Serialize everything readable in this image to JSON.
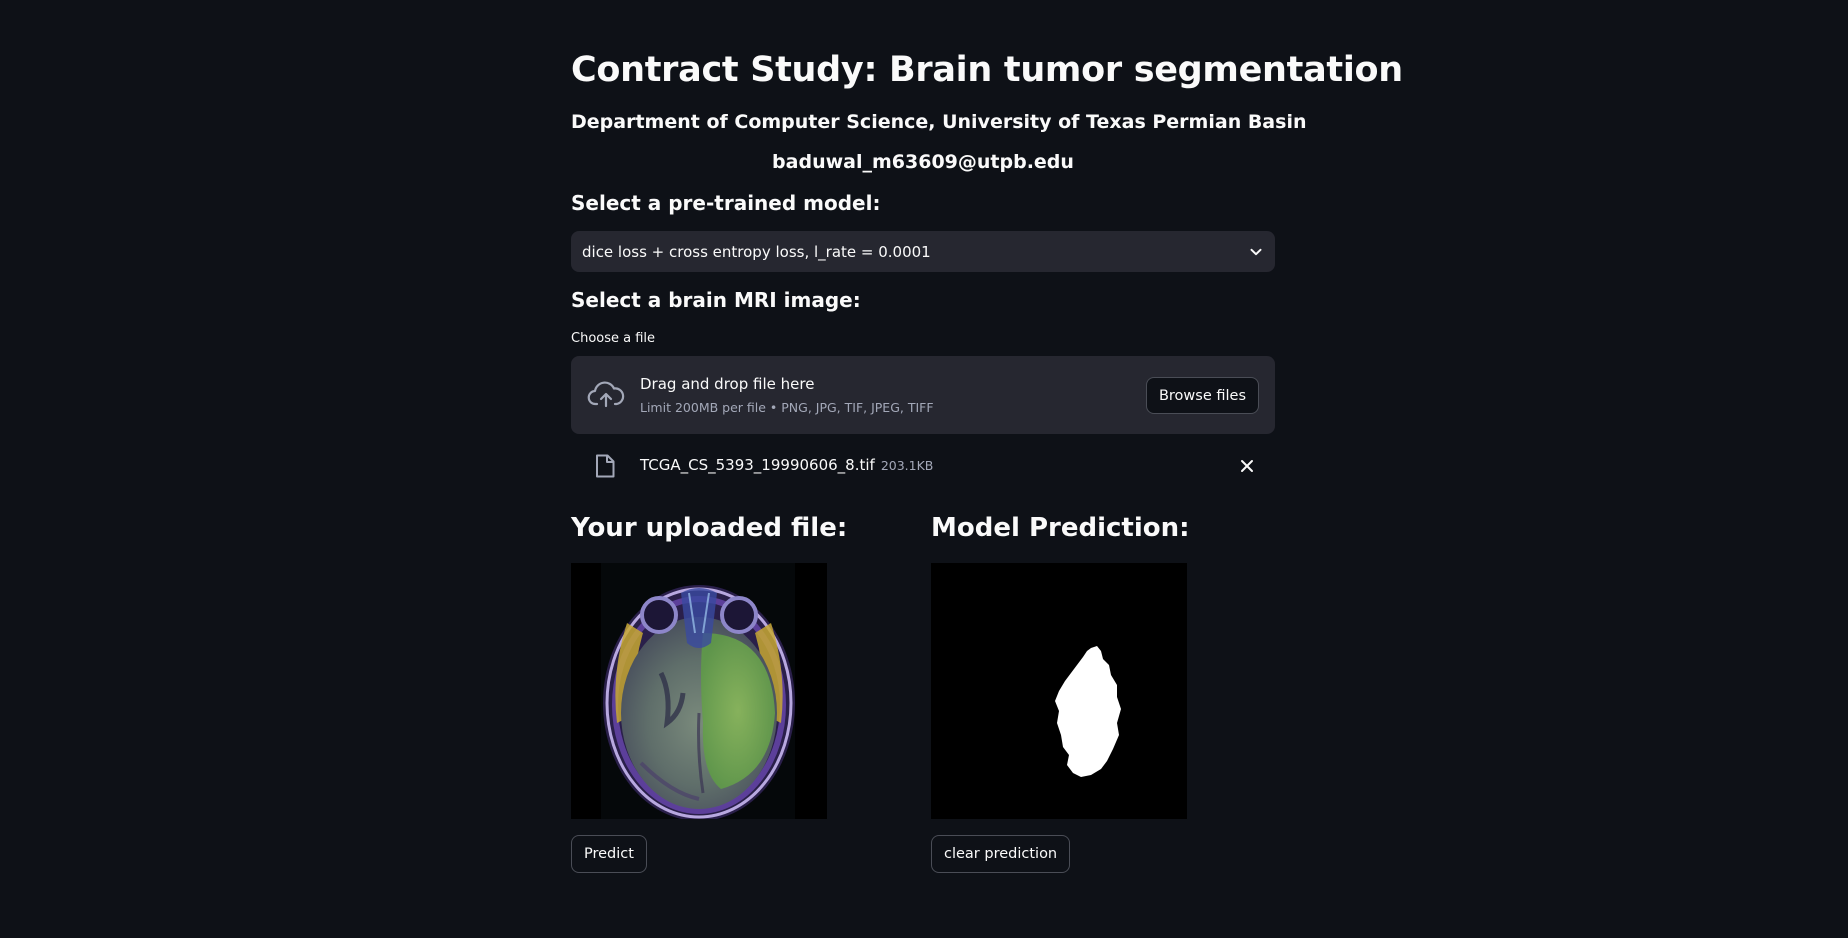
{
  "header": {
    "title": "Contract Study: Brain tumor segmentation",
    "department": "Department of Computer Science, University of Texas Permian Basin",
    "email": "baduwal_m63609@utpb.edu"
  },
  "model_select": {
    "label": "Select a pre-trained model:",
    "selected": "dice loss + cross entropy loss, l_rate = 0.0001"
  },
  "uploader": {
    "section_label": "Select a brain MRI image:",
    "field_label": "Choose a file",
    "drop_text": "Drag and drop file here",
    "limit_text": "Limit 200MB per file • PNG, JPG, TIF, JPEG, TIFF",
    "browse_label": "Browse files",
    "file": {
      "name": "TCGA_CS_5393_19990606_8.tif",
      "size": "203.1KB"
    }
  },
  "results": {
    "uploaded_title": "Your uploaded file:",
    "prediction_title": "Model Prediction:",
    "predict_label": "Predict",
    "clear_label": "clear prediction"
  },
  "colors": {
    "background": "#0e1117",
    "widget": "#262730",
    "text": "#fafafa",
    "muted": "#a3a8b8",
    "border": "#4a4d56"
  }
}
